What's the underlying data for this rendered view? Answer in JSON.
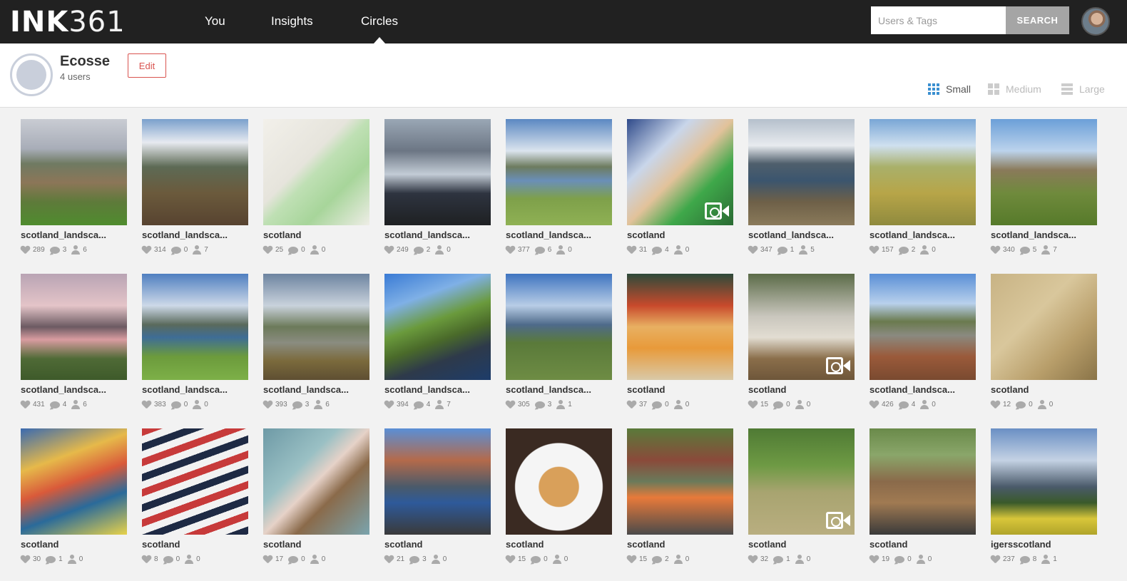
{
  "app": {
    "logo_bold": "INK",
    "logo_thin": "361"
  },
  "nav": {
    "items": [
      {
        "label": "You",
        "active": false
      },
      {
        "label": "Insights",
        "active": false
      },
      {
        "label": "Circles",
        "active": true
      }
    ]
  },
  "search": {
    "placeholder": "Users & Tags",
    "value": "",
    "button_label": "SEARCH"
  },
  "circle": {
    "name": "Ecosse",
    "count_label": "4 users",
    "edit_label": "Edit"
  },
  "size_options": [
    {
      "label": "Small",
      "active": true,
      "icon": "grid-small-icon"
    },
    {
      "label": "Medium",
      "active": false,
      "icon": "grid-medium-icon"
    },
    {
      "label": "Large",
      "active": false,
      "icon": "grid-large-icon"
    }
  ],
  "colors": {
    "accent": "#3a8fd0",
    "edit": "#d9534f",
    "topbar": "#212121"
  },
  "photos": [
    {
      "tag": "scotland_landsca...",
      "likes": "289",
      "comments": "3",
      "users": "6",
      "video": false,
      "bg": "linear-gradient(180deg,#c9ccd3 0%,#a8adb8 28%,#6f7a62 42%,#8c7658 60%,#5e7a3a 78%,#4f8c2e 100%)"
    },
    {
      "tag": "scotland_landsca...",
      "likes": "314",
      "comments": "0",
      "users": "7",
      "video": false,
      "bg": "linear-gradient(180deg,#7aa0cc 0%,#e7eaf0 22%,#5d6a55 45%,#6b5a3c 70%,#574330 100%)"
    },
    {
      "tag": "scotland",
      "likes": "25",
      "comments": "0",
      "users": "0",
      "video": false,
      "bg": "linear-gradient(135deg,#f2f0ea 0%,#e6e4dc 40%,#bfe0b4 50%,#a7d59a 70%,#eeede6 100%)"
    },
    {
      "tag": "scotland_landsca...",
      "likes": "249",
      "comments": "2",
      "users": "0",
      "video": false,
      "bg": "linear-gradient(180deg,#9aa7b5 0%,#6c7684 30%,#c3ccd6 52%,#2e3440 70%,#1e2022 100%)"
    },
    {
      "tag": "scotland_landsca...",
      "likes": "377",
      "comments": "6",
      "users": "0",
      "video": false,
      "bg": "linear-gradient(180deg,#5b88c2 0%,#dbe4ee 30%,#6d7b5e 45%,#6a8fb8 58%,#7ea04a 75%,#8fb154 100%)"
    },
    {
      "tag": "scotland",
      "likes": "31",
      "comments": "4",
      "users": "0",
      "video": true,
      "bg": "linear-gradient(135deg,#2f4a8a 0%,#c9d6ea 30%,#e2c29a 50%,#3fa84a 70%,#2a6a33 100%)"
    },
    {
      "tag": "scotland_landsca...",
      "likes": "347",
      "comments": "1",
      "users": "5",
      "video": false,
      "bg": "linear-gradient(180deg,#b5c0cc 0%,#e8ebef 25%,#4f5f6c 42%,#3b556e 58%,#6e6048 78%,#8a7a5a 100%)"
    },
    {
      "tag": "scotland_landsca...",
      "likes": "157",
      "comments": "2",
      "users": "0",
      "video": false,
      "bg": "linear-gradient(180deg,#79a6d6 0%,#cfe0ef 25%,#a9b06a 45%,#b7a548 70%,#8f8a3e 100%)"
    },
    {
      "tag": "scotland_landsca...",
      "likes": "340",
      "comments": "5",
      "users": "7",
      "video": false,
      "bg": "linear-gradient(180deg,#6b9fd8 0%,#bcd3ec 30%,#8a7a5a 48%,#6f8a3c 70%,#567a2a 100%)"
    },
    {
      "tag": "scotland_landsca...",
      "likes": "431",
      "comments": "4",
      "users": "6",
      "video": false,
      "bg": "linear-gradient(180deg,#b9a4b4 0%,#e4c4c8 30%,#6c5a62 50%,#d99ca0 62%,#4f6a36 80%,#3e5a2a 100%)"
    },
    {
      "tag": "scotland_landsca...",
      "likes": "383",
      "comments": "0",
      "users": "0",
      "video": false,
      "bg": "linear-gradient(180deg,#4f7fc0 0%,#cdd9e8 30%,#5a6a5c 48%,#3e6d96 60%,#6c9b3c 78%,#7db048 100%)"
    },
    {
      "tag": "scotland_landsca...",
      "likes": "393",
      "comments": "3",
      "users": "6",
      "video": false,
      "bg": "linear-gradient(180deg,#6d84a0 0%,#c9d2dc 30%,#6c7a5a 50%,#8a8c80 65%,#7b6a3c 82%,#5e4f32 100%)"
    },
    {
      "tag": "scotland_landsca...",
      "likes": "394",
      "comments": "4",
      "users": "7",
      "video": false,
      "bg": "linear-gradient(160deg,#3a7bd5 0%,#7fb0e6 25%,#6a9a3c 45%,#4a6a2a 60%,#2e3a4a 75%,#1d3c6a 100%)"
    },
    {
      "tag": "scotland_landsca...",
      "likes": "305",
      "comments": "3",
      "users": "1",
      "video": false,
      "bg": "linear-gradient(180deg,#3f74c0 0%,#b8cde6 30%,#4e6a8a 48%,#5a7a3a 65%,#6e8c44 100%)"
    },
    {
      "tag": "scotland",
      "likes": "37",
      "comments": "0",
      "users": "0",
      "video": false,
      "bg": "linear-gradient(180deg,#2d4a3a 0%,#c84a2c 30%,#e8b062 50%,#e89a3a 70%,#d9c9a8 100%)"
    },
    {
      "tag": "scotland",
      "likes": "15",
      "comments": "0",
      "users": "0",
      "video": true,
      "bg": "linear-gradient(180deg,#5b6b48 0%,#c9c6bd 40%,#e2ddd2 60%,#8a6e4a 80%,#6e563a 100%)"
    },
    {
      "tag": "scotland_landsca...",
      "likes": "426",
      "comments": "4",
      "users": "0",
      "video": false,
      "bg": "linear-gradient(180deg,#5a8fd6 0%,#b8d0ec 28%,#6a7a4e 45%,#8a8a80 58%,#9a5a3a 78%,#7a4a30 100%)"
    },
    {
      "tag": "scotland",
      "likes": "12",
      "comments": "0",
      "users": "0",
      "video": false,
      "bg": "linear-gradient(135deg,#c8b384 0%,#d9c79c 40%,#b89e6a 70%,#8a7448 100%)"
    },
    {
      "tag": "scotland",
      "likes": "30",
      "comments": "1",
      "users": "0",
      "video": false,
      "bg": "linear-gradient(160deg,#3a6ab0 0%,#e6b94a 30%,#d95a3a 50%,#2a6a9a 70%,#e8d24a 100%)"
    },
    {
      "tag": "scotland",
      "likes": "8",
      "comments": "0",
      "users": "0",
      "video": false,
      "bg": "repeating-linear-gradient(160deg,#c73a3a 0 10px,#f2f2f2 10px 20px,#1e2a44 20px 30px,#f2f2f2 30px 40px)"
    },
    {
      "tag": "scotland",
      "likes": "17",
      "comments": "0",
      "users": "0",
      "video": false,
      "bg": "linear-gradient(135deg,#6e9aa6 0%,#9ac0c4 35%,#e6d2c8 50%,#8a6a4a 65%,#7aa4ae 100%)"
    },
    {
      "tag": "scotland",
      "likes": "21",
      "comments": "3",
      "users": "0",
      "video": false,
      "bg": "linear-gradient(180deg,#5a8fd6 0%,#b46a4a 30%,#4a5a6a 55%,#2e5a9a 70%,#3a3a3a 100%)"
    },
    {
      "tag": "scotland",
      "likes": "15",
      "comments": "0",
      "users": "0",
      "video": false,
      "bg": "radial-gradient(circle at 50% 55%,#d9a05a 0 25%,#f5f5f5 26% 55%,#3a2a22 56%)"
    },
    {
      "tag": "scotland",
      "likes": "15",
      "comments": "2",
      "users": "0",
      "video": false,
      "bg": "linear-gradient(180deg,#5a7a3a 0%,#8a4a3a 30%,#6a7a5a 50%,#e87a3a 65%,#4a4a4a 100%)"
    },
    {
      "tag": "scotland",
      "likes": "32",
      "comments": "1",
      "users": "0",
      "video": true,
      "bg": "linear-gradient(180deg,#4f7a34 0%,#6e9a44 35%,#a8a470 60%,#b9ae80 100%)"
    },
    {
      "tag": "scotland",
      "likes": "19",
      "comments": "0",
      "users": "0",
      "video": false,
      "bg": "linear-gradient(180deg,#6a8a4a 0%,#8aa66a 25%,#8a6a4a 50%,#a07a52 70%,#3a3a3a 100%)"
    },
    {
      "tag": "igersscotland",
      "likes": "237",
      "comments": "8",
      "users": "1",
      "video": false,
      "bg": "linear-gradient(180deg,#6a8fc4 0%,#c4d2e4 30%,#4a5a6a 55%,#3a5a2a 70%,#d8c63a 85%,#b0a42a 100%)"
    }
  ]
}
